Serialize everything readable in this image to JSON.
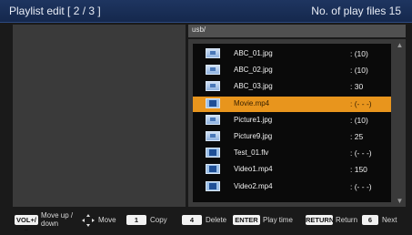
{
  "header": {
    "title": "Playlist edit  [ 2 / 3 ]",
    "play_files": "No. of play files   15"
  },
  "path": "usb/",
  "files": [
    {
      "name": "ABC_01.jpg",
      "value": ": (10)",
      "type": "image",
      "selected": false
    },
    {
      "name": "ABC_02.jpg",
      "value": ": (10)",
      "type": "image",
      "selected": false
    },
    {
      "name": "ABC_03.jpg",
      "value": ": 30",
      "type": "image",
      "selected": false
    },
    {
      "name": "Movie.mp4",
      "value": ": (- - -)",
      "type": "video",
      "selected": true
    },
    {
      "name": "Picture1.jpg",
      "value": ": (10)",
      "type": "image",
      "selected": false
    },
    {
      "name": "Picture9.jpg",
      "value": ": 25",
      "type": "image",
      "selected": false
    },
    {
      "name": "Test_01.flv",
      "value": ": (- - -)",
      "type": "video",
      "selected": false
    },
    {
      "name": "Video1.mp4",
      "value": ": 150",
      "type": "video",
      "selected": false
    },
    {
      "name": "Video2.mp4",
      "value": ": (- - -)",
      "type": "video",
      "selected": false
    }
  ],
  "footer": {
    "vol_key": "VOL+/−",
    "move_updown": "Move up /",
    "move_updown2": "down",
    "move": "Move",
    "copy_key": "1",
    "copy": "Copy",
    "delete_key": "4",
    "delete": "Delete",
    "enter_key": "ENTER",
    "play_time": "Play time",
    "return_key": "RETURN",
    "return": "Return",
    "next_key": "6",
    "next": "Next"
  }
}
